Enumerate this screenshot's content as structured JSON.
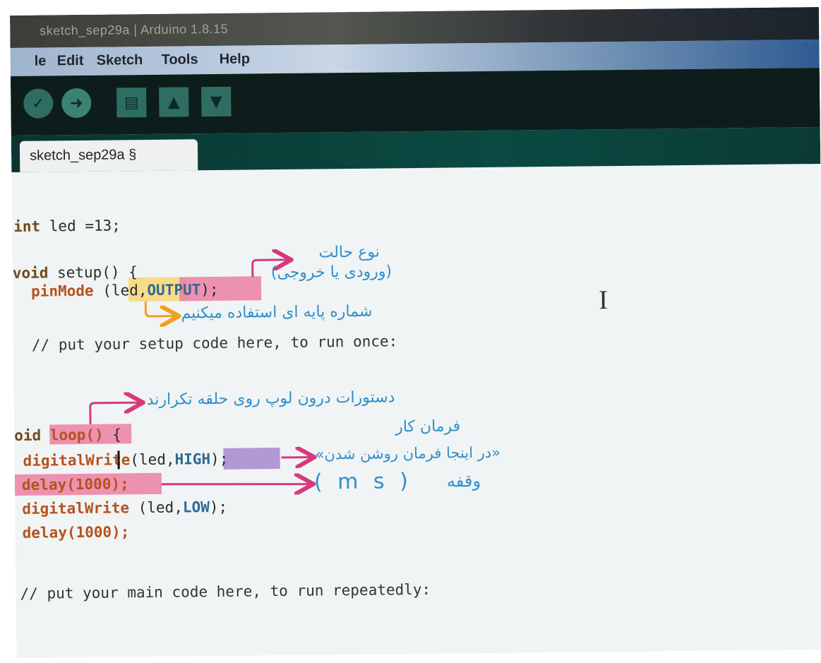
{
  "window": {
    "title": "sketch_sep29a | Arduino 1.8.15"
  },
  "menu": {
    "items": [
      "File",
      "Edit",
      "Sketch",
      "Tools",
      "Help"
    ],
    "display": [
      "le",
      "Edit",
      "Sketch",
      "Tools",
      "Help"
    ]
  },
  "toolbar": {
    "verify_icon": "check-icon",
    "upload_icon": "arrow-right-icon",
    "new_icon": "new-file-icon",
    "open_icon": "arrow-up-icon",
    "save_icon": "arrow-down-icon"
  },
  "tab": {
    "label": "sketch_sep29a §"
  },
  "code": {
    "l1_kw": "int",
    "l1_rest": " led =13;",
    "l2_kw": "void",
    "l2_rest": " setup() {",
    "l3_fn": "pinMode",
    "l3_a": " (led,",
    "l3_b": "OUTPUT",
    "l3_c": ");",
    "l4": "// put your setup code here, to run once:",
    "l5_kw": "oid",
    "l5_fn": " loop()",
    "l5_rest": " {",
    "l6_fn": "digitalWrite",
    "l6_a": "(led,",
    "l6_b": "HIGH",
    "l6_c": ");",
    "l7": "delay(1000);",
    "l8_fn": "digitalWrite",
    "l8_a": " (led,",
    "l8_b": "LOW",
    "l8_c": ");",
    "l9": "delay(1000);",
    "l10": "// put your main code here, to run repeatedly:"
  },
  "annotations": {
    "mode_title": "نوع حالت",
    "mode_desc": "(ورودی یا خروجی)",
    "pin_desc": "شماره پایه ای استفاده میکنیم",
    "loop_desc": "دستورات درون لوپ روی حلقه تکرارند",
    "command_title": "فرمان کار",
    "high_desc": "«در اینجا فرمان روشن شدن»",
    "delay_word": "وقفه",
    "delay_unit": "( m s )"
  },
  "colors": {
    "highlight_yellow": "#f7d774",
    "highlight_pink": "#ec7fa3",
    "highlight_purple": "#a88fd0",
    "annotation_blue": "#2f8fc9",
    "arrow_pink": "#d63a7a",
    "arrow_orange": "#f0a020"
  }
}
